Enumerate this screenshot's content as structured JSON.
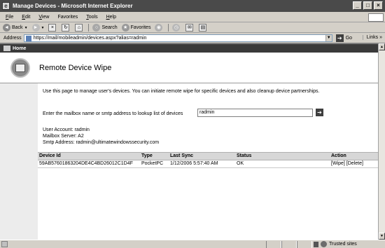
{
  "window": {
    "title": "Manage Devices - Microsoft Internet Explorer",
    "buttons": [
      "_",
      "□",
      "×"
    ]
  },
  "menu": {
    "items": [
      {
        "u": "F",
        "rest": "ile"
      },
      {
        "u": "E",
        "rest": "dit"
      },
      {
        "u": "V",
        "rest": "iew"
      },
      {
        "u": "",
        "rest": "Favorites"
      },
      {
        "u": "T",
        "rest": "ools"
      },
      {
        "u": "H",
        "rest": "elp"
      }
    ]
  },
  "toolbar": {
    "back": "Back",
    "search": "Search",
    "favorites": "Favorites"
  },
  "address": {
    "label": "Address",
    "url": "https://mail/mobileadmin/devices.aspx?alias=radmin",
    "go": "Go",
    "links": "Links"
  },
  "nav": {
    "home": "Home"
  },
  "page": {
    "title": "Remote Device Wipe",
    "description": "Use this page to manage user's devices. You can initiate remote wipe for specific devices and also cleanup device partnerships.",
    "lookup_label": "Enter the mailbox name or smtp address to lookup list of devices",
    "lookup_value": "radmin",
    "user_account": "User Account: radmin",
    "mailbox_server": "Mailbox Server: A2",
    "smtp_address": "Smtp Address: radmin@ultimatewindowssecurity.com"
  },
  "table": {
    "headers": {
      "device_id": "Device Id",
      "type": "Type",
      "last_sync": "Last Sync",
      "status": "Status",
      "action": "Action"
    },
    "rows": [
      {
        "device_id": "59AB57601863204DE4C4BD26012C1D4F",
        "type": "PocketPC",
        "last_sync": "1/12/2006 5:57:40 AM",
        "status": "OK",
        "wipe": "[Wipe]",
        "delete": "[Delete]"
      }
    ]
  },
  "status": {
    "zone": "Trusted sites"
  },
  "colors": {
    "title_bar": "#4a4a4a",
    "nav_bar": "#3a3a3a",
    "panel_bg": "#ffffff",
    "grid_header": "#d7d7d7"
  }
}
